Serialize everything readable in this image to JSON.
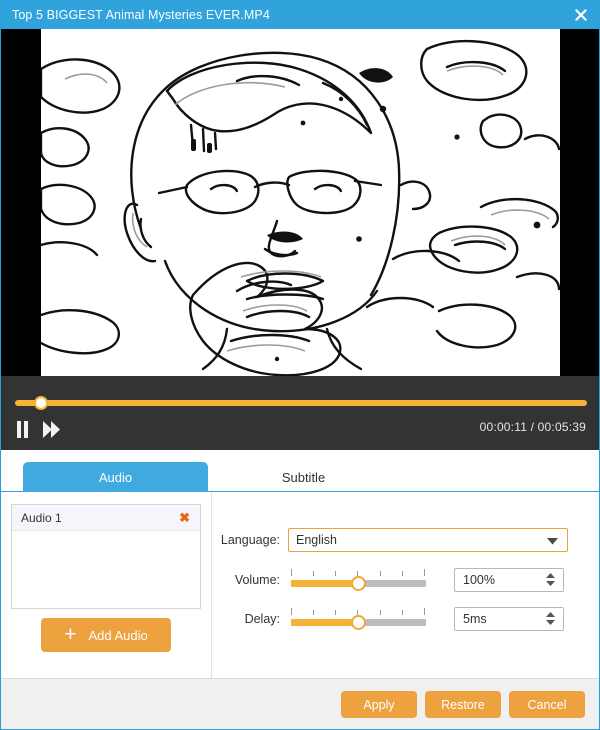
{
  "window": {
    "title": "Top 5 BIGGEST Animal Mysteries EVER.MP4",
    "close_icon": "close-icon",
    "accent_blue": "#30a2dc",
    "accent_orange": "#eda13f",
    "slider_orange": "#f5b335"
  },
  "player": {
    "pause_icon": "pause-icon",
    "forward_icon": "fast-forward-icon",
    "current_time": "00:00:11",
    "separator": "/",
    "total_time": "00:05:39",
    "timecode": "00:00:11 / 00:05:39",
    "progress_percent": 3,
    "bar_background": "#333333"
  },
  "tabs": [
    {
      "label": "Audio",
      "active": true
    },
    {
      "label": "Subtitle",
      "active": false
    }
  ],
  "audio_panel": {
    "tracks": [
      {
        "name": "Audio 1",
        "delete_icon": "✖"
      }
    ],
    "add_button": {
      "label": "Add Audio",
      "icon": "+"
    }
  },
  "settings": {
    "language": {
      "label": "Language:",
      "value": "English",
      "caret_icon": "chevron-down-icon"
    },
    "volume": {
      "label": "Volume:",
      "value": "100%",
      "slider_percent": 50,
      "tick_count": 7
    },
    "delay": {
      "label": "Delay:",
      "value": "5ms",
      "slider_percent": 50,
      "tick_count": 7
    }
  },
  "footer": {
    "apply_label": "Apply",
    "restore_label": "Restore",
    "cancel_label": "Cancel"
  }
}
